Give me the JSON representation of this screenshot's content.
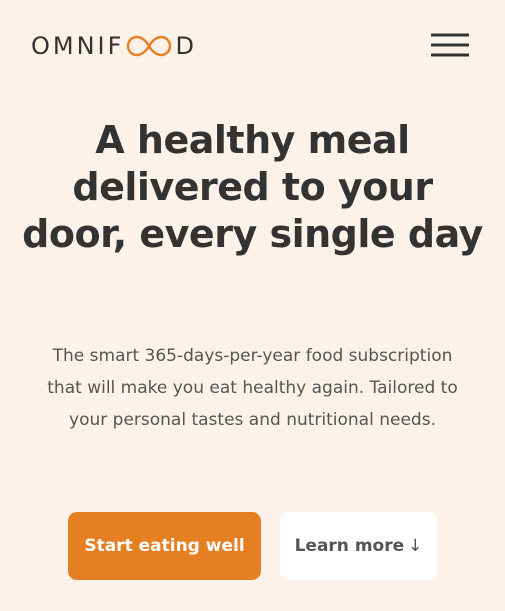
{
  "header": {
    "logo_prefix": "OMNIF",
    "logo_suffix": "D",
    "logo_mark_icon": "infinity-oo-icon",
    "menu_icon": "hamburger-menu-icon"
  },
  "hero": {
    "title": "A healthy meal delivered to your door, every single day",
    "description": "The smart 365-days-per-year food subscription that will make you eat healthy again. Tailored to your personal tastes and nutritional needs.",
    "primary_cta": "Start eating well",
    "secondary_cta": "Learn more",
    "secondary_cta_arrow": "↓"
  },
  "colors": {
    "background": "#fdf2e9",
    "accent": "#e67e22",
    "text_dark": "#333333",
    "text_body": "#555555",
    "secondary_button_bg": "#ffffff"
  }
}
